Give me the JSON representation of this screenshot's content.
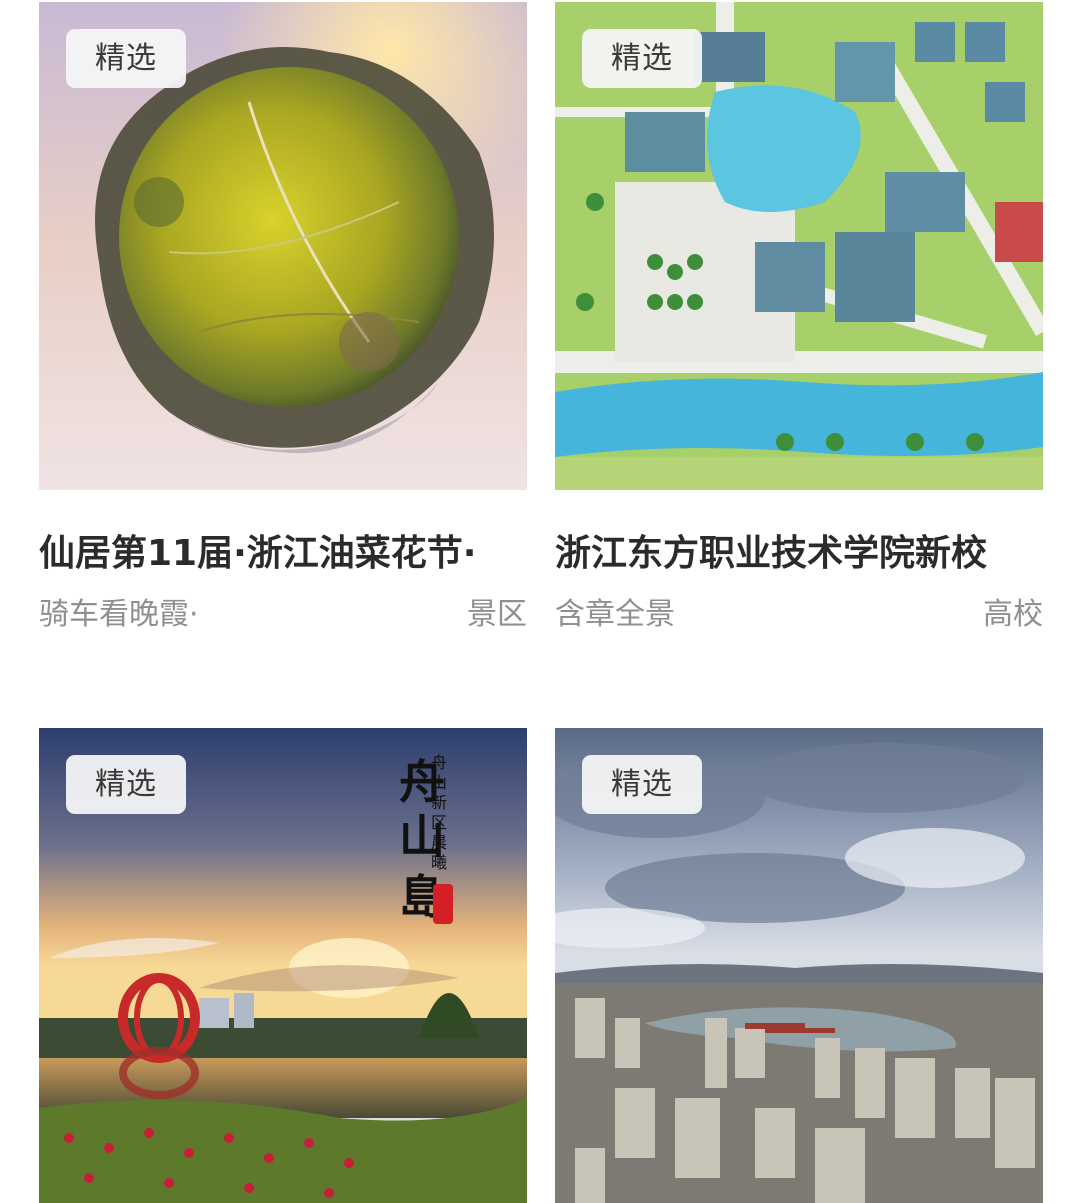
{
  "cards": [
    {
      "badge": "精选",
      "title": "仙居第11届·浙江油菜花节·",
      "author": "骑车看晚霞·",
      "category": "景区",
      "image": "tiny-planet-rapeseed-fields"
    },
    {
      "badge": "精选",
      "title": "浙江东方职业技术学院新校",
      "author": "含章全景",
      "category": "高校",
      "image": "campus-illustrated-map"
    },
    {
      "badge": "精选",
      "title": "",
      "author": "",
      "category": "",
      "image": "zhoushan-island-lake-sunrise",
      "image_text": {
        "big": "舟山島",
        "small": "舟山新区晨曦",
        "seal": "闪光影"
      }
    },
    {
      "badge": "精选",
      "title": "",
      "author": "",
      "category": "",
      "image": "aerial-city-river-cloudy"
    }
  ],
  "colors": {
    "title": "#2b2b2b",
    "meta": "#8f8f8f",
    "badge_bg": "#f4f4f6"
  }
}
